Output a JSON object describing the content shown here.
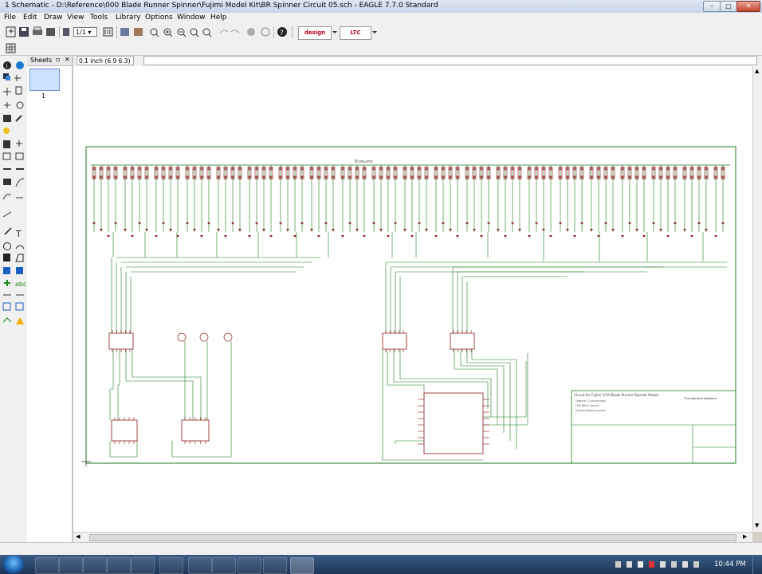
{
  "window": {
    "title": "1 Schematic - D:\\Reference\\000 Blade Runner Spinner\\Fujimi Model Kit\\BR Spinner Circuit 05.sch - EAGLE 7.7.0 Standard",
    "controls": [
      "minimize",
      "maximize",
      "close"
    ]
  },
  "menu": [
    "File",
    "Edit",
    "Draw",
    "View",
    "Tools",
    "Library",
    "Options",
    "Window",
    "Help"
  ],
  "toolbar": {
    "sheet_select": "1/1",
    "design_link": "design link",
    "ltc_spice": "LTC SPICE"
  },
  "sheets_panel": {
    "title": "Sheets",
    "sheet_number": "1"
  },
  "coordinate": "0.1 inch (6.9 6.3)",
  "schematic": {
    "top_bus_label": "BlueLeds",
    "title_block": {
      "heading": "Circuit for Fujimi 1/24 Blade Runner Spinner Model",
      "right_label": "Thunderbird Software",
      "lines": [
        "Legend / Connections",
        "LED Blink Circuit",
        "Control Board Layout"
      ]
    }
  },
  "taskbar": {
    "time": "10:44 PM"
  },
  "colors": {
    "wire": "#1e7a1e",
    "part": "#8b1a1a",
    "frame": "#1e7a1e",
    "titlebar": "#c6d5e8",
    "taskbar": "#1c3457"
  }
}
